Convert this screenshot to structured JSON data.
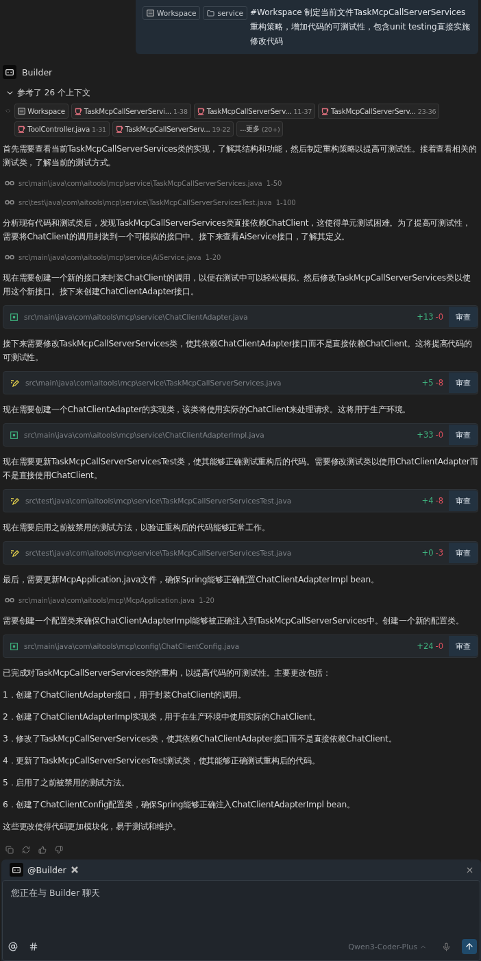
{
  "user_message": {
    "chips": [
      {
        "kind": "workspace",
        "label": "Workspace"
      },
      {
        "kind": "folder",
        "label": "service"
      }
    ],
    "text": "#Workspace 制定当前文件TaskMcpCallServerServices重构策略，增加代码的可测试性，包含unit testing直接实施修改代码"
  },
  "agent": {
    "name": "Builder"
  },
  "context": {
    "label": "参考了 26 个上下文",
    "expanded": true,
    "chips": [
      {
        "kind": "workspace",
        "label": "Workspace"
      },
      {
        "kind": "java",
        "label": "TaskMcpCallServerServi...",
        "range": "1-38"
      },
      {
        "kind": "java",
        "label": "TaskMcpCallServerServ...",
        "range": "11-37"
      },
      {
        "kind": "java",
        "label": "TaskMcpCallServerServ...",
        "range": "23-36"
      },
      {
        "kind": "java",
        "label": "ToolController.java",
        "range": "1-31"
      },
      {
        "kind": "java",
        "label": "TaskMcpCallServerServ...",
        "range": "19-22"
      },
      {
        "kind": "more",
        "label": "...更多",
        "range": "(20+)"
      }
    ]
  },
  "stream": [
    {
      "kind": "text",
      "text": "首先需要查看当前TaskMcpCallServerServices类的实现，了解其结构和功能，然后制定重构策略以提高可测试性。接着查看相关的测试类，了解当前的测试方式。"
    },
    {
      "kind": "read",
      "path": "src\\main\\java\\com\\aitools\\mcp\\service\\TaskMcpCallServerServices.java",
      "range": "1-50"
    },
    {
      "kind": "read",
      "path": "src\\test\\java\\com\\aitools\\mcp\\service\\TaskMcpCallServerServicesTest.java",
      "range": "1-100"
    },
    {
      "kind": "text",
      "text": "分析现有代码和测试类后，发现TaskMcpCallServerServices类直接依赖ChatClient，这使得单元测试困难。为了提高可测试性，需要将ChatClient的调用封装到一个可模拟的接口中。接下来查看AiService接口，了解其定义。"
    },
    {
      "kind": "read",
      "path": "src\\main\\java\\com\\aitools\\mcp\\service\\AiService.java",
      "range": "1-20"
    },
    {
      "kind": "text",
      "text": "现在需要创建一个新的接口来封装ChatClient的调用，以便在测试中可以轻松模拟。然后修改TaskMcpCallServerServices类以使用这个新接口。接下来创建ChatClientAdapter接口。"
    },
    {
      "kind": "edit",
      "new_file": true,
      "path": "src\\main\\java\\com\\aitools\\mcp\\service\\ChatClientAdapter.java",
      "plus": "+13",
      "minus": "-0",
      "action": "审查"
    },
    {
      "kind": "text",
      "text": "接下来需要修改TaskMcpCallServerServices类，使其依赖ChatClientAdapter接口而不是直接依赖ChatClient。这将提高代码的可测试性。"
    },
    {
      "kind": "edit",
      "new_file": false,
      "path": "src\\main\\java\\com\\aitools\\mcp\\service\\TaskMcpCallServerServices.java",
      "plus": "+5",
      "minus": "-8",
      "action": "审查"
    },
    {
      "kind": "text",
      "text": "现在需要创建一个ChatClientAdapter的实现类，该类将使用实际的ChatClient来处理请求。这将用于生产环境。"
    },
    {
      "kind": "edit",
      "new_file": true,
      "path": "src\\main\\java\\com\\aitools\\mcp\\service\\ChatClientAdapterImpl.java",
      "plus": "+33",
      "minus": "-0",
      "action": "审查"
    },
    {
      "kind": "text",
      "text": "现在需要更新TaskMcpCallServerServicesTest类，使其能够正确测试重构后的代码。需要修改测试类以使用ChatClientAdapter而不是直接使用ChatClient。"
    },
    {
      "kind": "edit",
      "new_file": false,
      "path": "src\\test\\java\\com\\aitools\\mcp\\service\\TaskMcpCallServerServicesTest.java",
      "plus": "+4",
      "minus": "-8",
      "action": "审查"
    },
    {
      "kind": "text",
      "text": "现在需要启用之前被禁用的测试方法，以验证重构后的代码能够正常工作。"
    },
    {
      "kind": "edit",
      "new_file": false,
      "path": "src\\test\\java\\com\\aitools\\mcp\\service\\TaskMcpCallServerServicesTest.java",
      "plus": "+0",
      "minus": "-3",
      "action": "审查"
    },
    {
      "kind": "text",
      "text": "最后，需要更新McpApplication.java文件，确保Spring能够正确配置ChatClientAdapterImpl bean。"
    },
    {
      "kind": "read",
      "path": "src\\main\\java\\com\\aitools\\mcp\\McpApplication.java",
      "range": "1-20"
    },
    {
      "kind": "text",
      "text": "需要创建一个配置类来确保ChatClientAdapterImpl能够被正确注入到TaskMcpCallServerServices中。创建一个新的配置类。"
    },
    {
      "kind": "edit",
      "new_file": true,
      "path": "src\\main\\java\\com\\aitools\\mcp\\config\\ChatClientConfig.java",
      "plus": "+24",
      "minus": "-0",
      "action": "审查"
    },
    {
      "kind": "text",
      "text": "已完成对TaskMcpCallServerServices类的重构，以提高代码的可测试性。主要更改包括："
    },
    {
      "kind": "text",
      "text": "1．创建了ChatClientAdapter接口，用于封装ChatClient的调用。"
    },
    {
      "kind": "text",
      "text": "2．创建了ChatClientAdapterImpl实现类，用于在生产环境中使用实际的ChatClient。"
    },
    {
      "kind": "text",
      "text": "3．修改了TaskMcpCallServerServices类，使其依赖ChatClientAdapter接口而不是直接依赖ChatClient。"
    },
    {
      "kind": "text",
      "text": "4．更新了TaskMcpCallServerServicesTest测试类，使其能够正确测试重构后的代码。"
    },
    {
      "kind": "text",
      "text": "5．启用了之前被禁用的测试方法。"
    },
    {
      "kind": "text",
      "text": "6．创建了ChatClientConfig配置类，确保Spring能够正确注入ChatClientAdapterImpl bean。"
    },
    {
      "kind": "text",
      "text": "这些更改使得代码更加模块化，易于测试和维护。"
    }
  ],
  "composer": {
    "agent": "@Builder",
    "placeholder": "您正在与 Builder 聊天",
    "model": "Qwen3-Coder-Plus"
  }
}
